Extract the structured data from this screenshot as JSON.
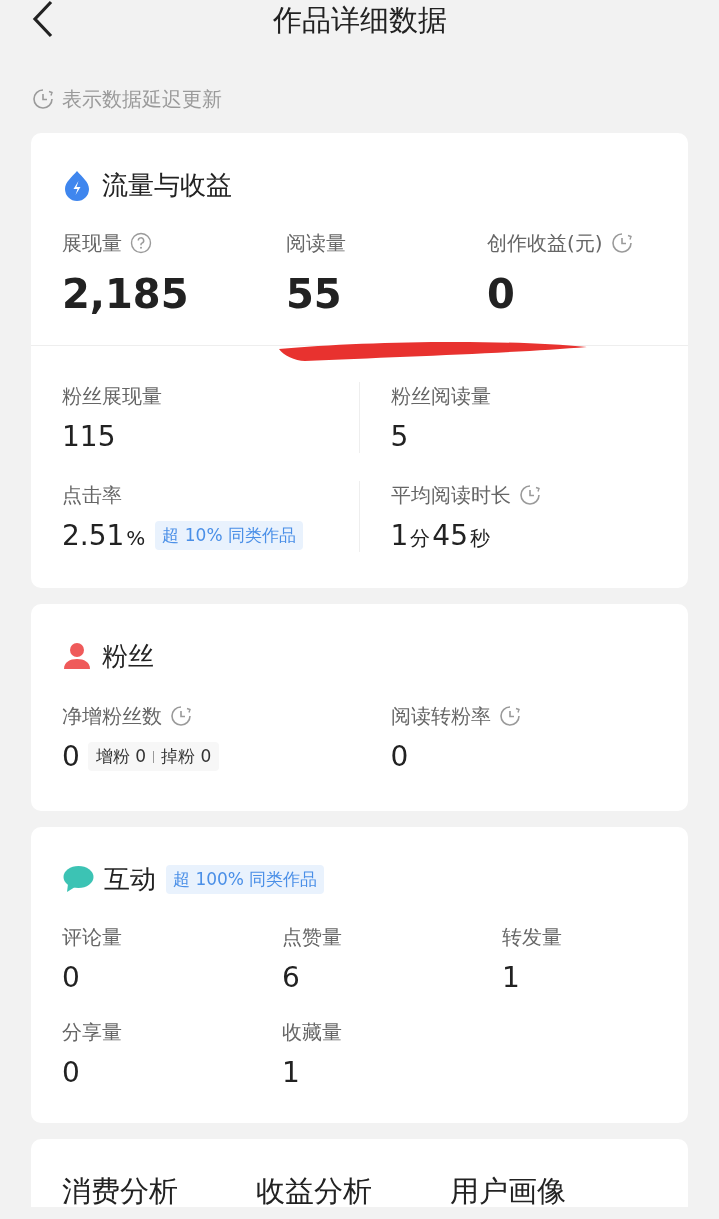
{
  "header": {
    "title": "作品详细数据"
  },
  "notice": {
    "text": "表示数据延迟更新"
  },
  "sections": [
    {
      "kind": "traffic",
      "title": "流量与收益",
      "top_metrics": [
        {
          "label": "展现量",
          "help": true,
          "parts": [
            {
              "text": "2,185",
              "kind": "num"
            }
          ]
        },
        {
          "label": "阅读量",
          "parts": [
            {
              "text": "55",
              "kind": "num"
            }
          ]
        },
        {
          "label": "创作收益(元)",
          "delayed": true,
          "parts": [
            {
              "text": "0",
              "kind": "num"
            }
          ]
        }
      ],
      "grid": [
        {
          "label": "粉丝展现量",
          "parts": [
            {
              "text": "115",
              "kind": "num"
            }
          ]
        },
        {
          "label": "粉丝阅读量",
          "parts": [
            {
              "text": "5",
              "kind": "num"
            }
          ]
        },
        {
          "label": "点击率",
          "parts": [
            {
              "text": "2.51",
              "kind": "num"
            },
            {
              "text": "%",
              "kind": "unit"
            }
          ],
          "badge": "超 10% 同类作品"
        },
        {
          "label": "平均阅读时长",
          "delayed": true,
          "parts": [
            {
              "text": "1",
              "kind": "num"
            },
            {
              "text": "分",
              "kind": "unit"
            },
            {
              "text": "45",
              "kind": "num"
            },
            {
              "text": "秒",
              "kind": "unit"
            }
          ]
        }
      ]
    },
    {
      "kind": "fans",
      "title": "粉丝",
      "grid": [
        {
          "label": "净增粉丝数",
          "delayed": true,
          "parts": [
            {
              "text": "0",
              "kind": "num"
            }
          ],
          "breakdown": [
            {
              "label": "增粉",
              "value": "0"
            },
            {
              "label": "掉粉",
              "value": "0"
            }
          ]
        },
        {
          "label": "阅读转粉率",
          "delayed": true,
          "parts": [
            {
              "text": "0",
              "kind": "num"
            }
          ]
        }
      ]
    },
    {
      "kind": "interaction",
      "title": "互动",
      "badge": "超 100% 同类作品",
      "grid3": [
        {
          "label": "评论量",
          "parts": [
            {
              "text": "0",
              "kind": "num"
            }
          ]
        },
        {
          "label": "点赞量",
          "parts": [
            {
              "text": "6",
              "kind": "num"
            }
          ]
        },
        {
          "label": "转发量",
          "parts": [
            {
              "text": "1",
              "kind": "num"
            }
          ]
        },
        {
          "label": "分享量",
          "parts": [
            {
              "text": "0",
              "kind": "num"
            }
          ]
        },
        {
          "label": "收藏量",
          "parts": [
            {
              "text": "1",
              "kind": "num"
            }
          ]
        }
      ]
    }
  ],
  "analysis_tabs": [
    {
      "label": "消费分析"
    },
    {
      "label": "收益分析"
    },
    {
      "label": "用户画像"
    }
  ]
}
